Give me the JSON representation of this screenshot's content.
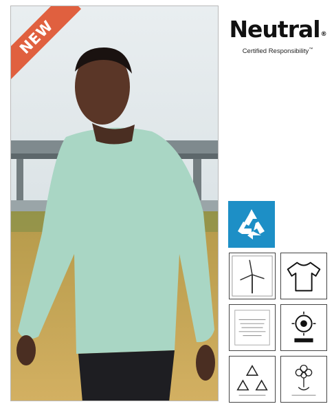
{
  "ribbon": {
    "label": "NEW"
  },
  "brand": {
    "name": "Neutral",
    "registered": "®",
    "tagline": "Certified Responsibility",
    "trademark": "™"
  },
  "certifications": {
    "icons": [
      "recycle-icon",
      "wind-turbine-icon",
      "t-shirt-icon",
      "text-certificate-icon",
      "sun-badge-icon",
      "recycle-outline-icon",
      "ecolabel-flower-icon"
    ]
  },
  "colors": {
    "ribbon": "#e0603f",
    "recycle_badge": "#1d8fc6",
    "shirt": "#a9d6c4"
  }
}
